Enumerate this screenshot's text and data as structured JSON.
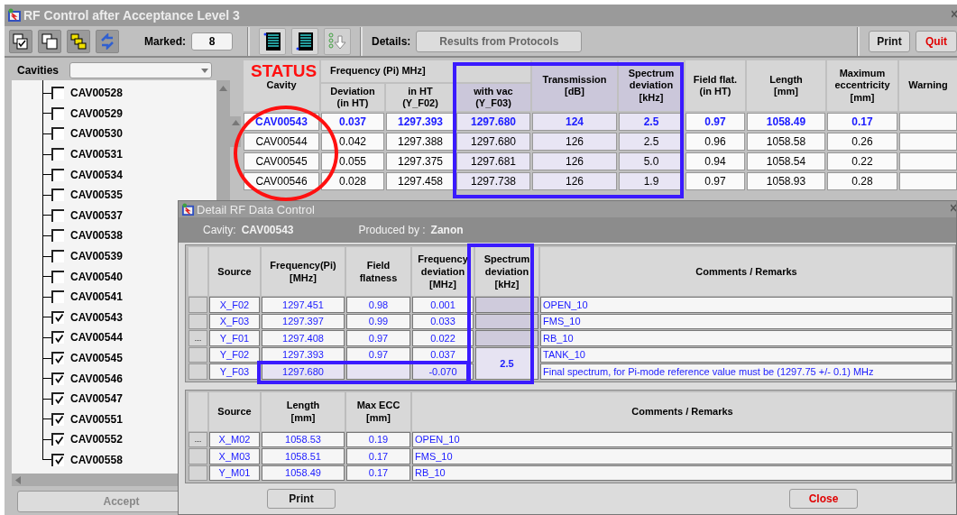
{
  "window": {
    "title": "RF Control after Acceptance Level 3"
  },
  "toolbar": {
    "marked_label": "Marked:",
    "marked_value": "8",
    "details_label": "Details:",
    "details_button": "Results from Protocols",
    "print_button": "Print",
    "quit_button": "Quit"
  },
  "cavities": {
    "label": "Cavities",
    "accept_button": {
      "label": "Accept",
      "disabled": true
    },
    "items": [
      {
        "label": "CAV00528",
        "checked": false
      },
      {
        "label": "CAV00529",
        "checked": false
      },
      {
        "label": "CAV00530",
        "checked": false
      },
      {
        "label": "CAV00531",
        "checked": false
      },
      {
        "label": "CAV00534",
        "checked": false
      },
      {
        "label": "CAV00535",
        "checked": false
      },
      {
        "label": "CAV00537",
        "checked": false
      },
      {
        "label": "CAV00538",
        "checked": false
      },
      {
        "label": "CAV00539",
        "checked": false
      },
      {
        "label": "CAV00540",
        "checked": false
      },
      {
        "label": "CAV00541",
        "checked": false
      },
      {
        "label": "CAV00543",
        "checked": true
      },
      {
        "label": "CAV00544",
        "checked": true
      },
      {
        "label": "CAV00545",
        "checked": true
      },
      {
        "label": "CAV00546",
        "checked": true
      },
      {
        "label": "CAV00547",
        "checked": true
      },
      {
        "label": "CAV00551",
        "checked": true
      },
      {
        "label": "CAV00552",
        "checked": true
      },
      {
        "label": "CAV00558",
        "checked": true
      }
    ]
  },
  "main_table": {
    "column_group": "Frequency (Pi) MHz]",
    "columns": [
      {
        "label": "Cavity",
        "shaded": false,
        "grouped": false
      },
      {
        "label": "Deviation\n(in HT)",
        "shaded": false,
        "grouped": true
      },
      {
        "label": "in HT\n(Y_F02)",
        "shaded": false,
        "grouped": true
      },
      {
        "label": "with vac\n(Y_F03)",
        "shaded": true,
        "grouped": true
      },
      {
        "label": "Transmission\n[dB]",
        "shaded": true,
        "grouped": false
      },
      {
        "label": "Spectrum\ndeviation\n[kHz]",
        "shaded": true,
        "grouped": false
      },
      {
        "label": "Field flat.\n(in HT)",
        "shaded": false,
        "grouped": false
      },
      {
        "label": "Length\n[mm]",
        "shaded": false,
        "grouped": false
      },
      {
        "label": "Maximum\neccentricity\n[mm]",
        "shaded": false,
        "grouped": false
      },
      {
        "label": "Warning",
        "shaded": false,
        "grouped": false
      }
    ],
    "rows": [
      {
        "selected": true,
        "cells": [
          "CAV00543",
          "0.037",
          "1297.393",
          "1297.680",
          "124",
          "2.5",
          "0.97",
          "1058.49",
          "0.17"
        ]
      },
      {
        "selected": false,
        "cells": [
          "CAV00544",
          "0.042",
          "1297.388",
          "1297.680",
          "126",
          "2.5",
          "0.96",
          "1058.58",
          "0.26"
        ]
      },
      {
        "selected": false,
        "cells": [
          "CAV00545",
          "0.055",
          "1297.375",
          "1297.681",
          "126",
          "5.0",
          "0.94",
          "1058.54",
          "0.22"
        ]
      },
      {
        "selected": false,
        "cells": [
          "CAV00546",
          "0.028",
          "1297.458",
          "1297.738",
          "126",
          "1.9",
          "0.97",
          "1058.93",
          "0.28"
        ]
      }
    ]
  },
  "detail_dialog": {
    "title": "Detail RF Data Control",
    "cavity_label": "Cavity:",
    "cavity_value": "CAV00543",
    "produced_label": "Produced by :",
    "produced_value": "Zanon",
    "frequency_table": {
      "columns": [
        "Source",
        "Frequency(Pi)\n[MHz]",
        "Field\nflatness",
        "Frequency\ndeviation\n[MHz]",
        "Spectrum\ndeviation\n[kHz]",
        "Comments / Remarks"
      ],
      "spectrum_deviation_merged": "2.5",
      "rows": [
        {
          "highlighted": false,
          "source": "X_F02",
          "frequency": "1297.451",
          "field_flatness": "0.98",
          "frequency_deviation": "0.001",
          "comment": "OPEN_10"
        },
        {
          "highlighted": false,
          "source": "X_F03",
          "frequency": "1297.397",
          "field_flatness": "0.99",
          "frequency_deviation": "0.033",
          "comment": "FMS_10"
        },
        {
          "highlighted": false,
          "row_button": "...",
          "source": "Y_F01",
          "frequency": "1297.408",
          "field_flatness": "0.97",
          "frequency_deviation": "0.022",
          "comment": "RB_10"
        },
        {
          "highlighted": false,
          "source": "Y_F02",
          "frequency": "1297.393",
          "field_flatness": "0.97",
          "frequency_deviation": "0.037",
          "comment": "TANK_10"
        },
        {
          "highlighted": true,
          "source": "Y_F03",
          "frequency": "1297.680",
          "frequency_deviation": "-0.070",
          "comment": "Final spectrum, for Pi-mode reference value must be (1297.75 +/- 0.1) MHz"
        }
      ]
    },
    "length_table": {
      "columns": [
        "Source",
        "Length\n[mm]",
        "Max ECC\n[mm]",
        "Comments / Remarks"
      ],
      "rows": [
        {
          "row_button": "...",
          "source": "X_M02",
          "length": "1058.53",
          "max_ecc": "0.19",
          "comment": "OPEN_10"
        },
        {
          "source": "X_M03",
          "length": "1058.51",
          "max_ecc": "0.17",
          "comment": "FMS_10"
        },
        {
          "source": "Y_M01",
          "length": "1058.49",
          "max_ecc": "0.17",
          "comment": "RB_10"
        }
      ]
    },
    "print_button": "Print",
    "close_button": "Close"
  },
  "annotations": [
    {
      "kind": "label",
      "text": "STATUS"
    },
    {
      "kind": "ellipse"
    },
    {
      "kind": "rectangle"
    },
    {
      "kind": "rectangle"
    },
    {
      "kind": "rectangle"
    }
  ]
}
